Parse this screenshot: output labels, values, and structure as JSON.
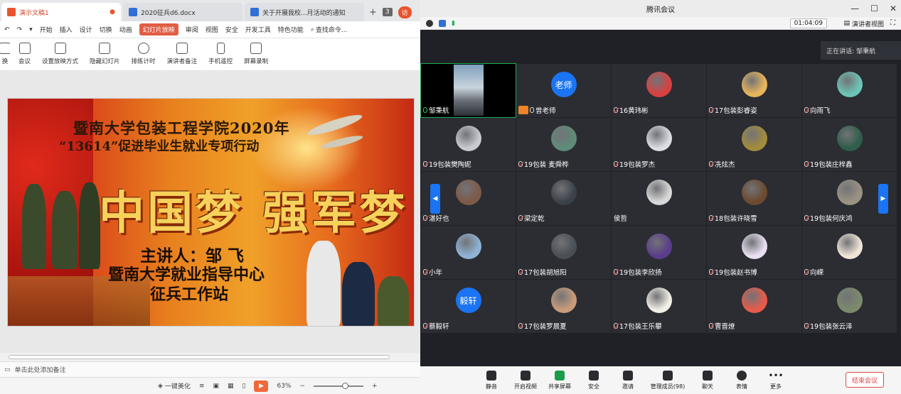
{
  "wps": {
    "tabs": [
      {
        "label": "演示文稿1",
        "color": "#e8542e"
      },
      {
        "label": "2020征兵d6.docx",
        "color": "#2f6fd6"
      },
      {
        "label": "关于开展我校...月活动的通知",
        "color": "#2f6fd6"
      }
    ],
    "tab_count": "3",
    "tab_edge_label": "访",
    "menu": [
      "开始",
      "插入",
      "设计",
      "切换",
      "动画",
      "幻灯片放映",
      "审阅",
      "视图",
      "安全",
      "开发工具",
      "特色功能"
    ],
    "active_menu": "幻灯片放映",
    "search_label": "查找命令...",
    "toolbar": [
      "换",
      "会议",
      "设置放映方式",
      "隐藏幻灯片",
      "排练计时",
      "演讲者备注",
      "手机遥控",
      "屏幕录制"
    ],
    "slide": {
      "line1": "暨南大学包装工程学院2020年",
      "line2": "“13614”促进毕业生就业专项行动",
      "headline": "中国梦 强军梦",
      "speaker": "主讲人：邹 飞",
      "org1": "暨南大学就业指导中心",
      "org2": "征兵工作站"
    },
    "notes_placeholder": "单击此处添加备注",
    "beautify_label": "一键美化",
    "zoom": "63%"
  },
  "meeting": {
    "title": "腾讯会议",
    "timer": "01:04:09",
    "view_mode": "演讲者视图",
    "speaking_label": "正在讲话: 邹秉航",
    "participants": [
      {
        "name": "邹秉航",
        "mic": "on",
        "type": "video"
      },
      {
        "name": "曾老师",
        "mic": "host",
        "type": "text",
        "avatar_text": "老师"
      },
      {
        "name": "16黄玮彬",
        "mic": "off",
        "type": "img",
        "color": "#d94040"
      },
      {
        "name": "17包装彭睿姿",
        "mic": "off",
        "type": "img",
        "color": "#e7b55a"
      },
      {
        "name": "向雨飞",
        "mic": "off",
        "type": "img",
        "color": "#6cc5b6"
      },
      {
        "name": "19包装樊陶妮",
        "mic": "off",
        "type": "img",
        "color": "#c9c9d2"
      },
      {
        "name": "19包装 麦舜桦",
        "mic": "off",
        "type": "img",
        "color": "#5f8b79"
      },
      {
        "name": "19包装罗杰",
        "mic": "off",
        "type": "img",
        "color": "#dadde4"
      },
      {
        "name": "冼炫杰",
        "mic": "off",
        "type": "img",
        "color": "#a38c3b"
      },
      {
        "name": "19包装庄梓鑫",
        "mic": "off",
        "type": "img",
        "color": "#2f5d4a"
      },
      {
        "name": "湛好也",
        "mic": "off",
        "type": "img",
        "color": "#7d5a48"
      },
      {
        "name": "梁定乾",
        "mic": "off",
        "type": "img",
        "color": "#3c4048"
      },
      {
        "name": "侯哲",
        "mic": "none",
        "type": "img",
        "color": "#d8d8d8"
      },
      {
        "name": "18包装许晓雪",
        "mic": "off",
        "type": "img",
        "color": "#6c4a2e"
      },
      {
        "name": "19包装何庆鸿",
        "mic": "off",
        "type": "img",
        "color": "#9b9382"
      },
      {
        "name": "小年",
        "mic": "off",
        "type": "img",
        "color": "#8fb3d6"
      },
      {
        "name": "17包装胡旭阳",
        "mic": "off",
        "type": "img",
        "color": "#4a4e55"
      },
      {
        "name": "19包装李欣扬",
        "mic": "off",
        "type": "img",
        "color": "#5a3d8a"
      },
      {
        "name": "19包装赵书博",
        "mic": "off",
        "type": "img",
        "color": "#e8dff2"
      },
      {
        "name": "向嵘",
        "mic": "off",
        "type": "img",
        "color": "#f0e6d8"
      },
      {
        "name": "蔡毅轩",
        "mic": "off",
        "type": "text",
        "avatar_text": "毅轩"
      },
      {
        "name": "17包装罗晨夏",
        "mic": "off",
        "type": "img",
        "color": "#c99b7a"
      },
      {
        "name": "17包装王乐攀",
        "mic": "off",
        "type": "img",
        "color": "#f2efe6"
      },
      {
        "name": "曹晋燎",
        "mic": "off",
        "type": "img",
        "color": "#e85a4a"
      },
      {
        "name": "19包装张云泽",
        "mic": "off",
        "type": "img",
        "color": "#7b8a6a"
      }
    ],
    "controls": [
      "静音",
      "开启视频",
      "共享屏幕",
      "安全",
      "邀请",
      "管理成员(98)",
      "聊天",
      "表情",
      "更多"
    ],
    "end_label": "结束会议"
  }
}
